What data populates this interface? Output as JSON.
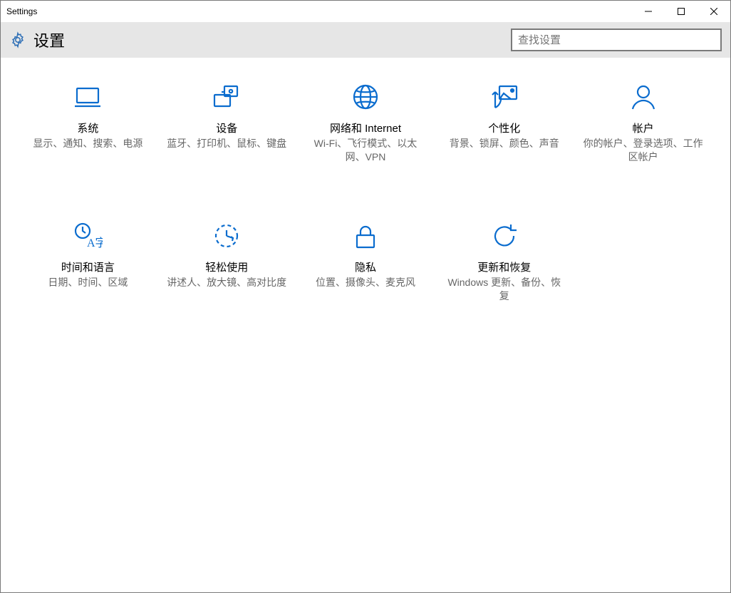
{
  "window": {
    "title": "Settings"
  },
  "header": {
    "title": "设置"
  },
  "search": {
    "placeholder": "查找设置"
  },
  "tiles": [
    {
      "icon": "system",
      "title": "系统",
      "desc": "显示、通知、搜索、电源"
    },
    {
      "icon": "devices",
      "title": "设备",
      "desc": "蓝牙、打印机、鼠标、键盘"
    },
    {
      "icon": "network",
      "title": "网络和 Internet",
      "desc": "Wi-Fi、飞行模式、以太网、VPN"
    },
    {
      "icon": "personal",
      "title": "个性化",
      "desc": "背景、锁屏、颜色、声音"
    },
    {
      "icon": "account",
      "title": "帐户",
      "desc": "你的帐户、登录选项、工作区帐户"
    },
    {
      "icon": "time",
      "title": "时间和语言",
      "desc": "日期、时间、区域"
    },
    {
      "icon": "ease",
      "title": "轻松使用",
      "desc": "讲述人、放大镜、高对比度"
    },
    {
      "icon": "privacy",
      "title": "隐私",
      "desc": "位置、摄像头、麦克风"
    },
    {
      "icon": "update",
      "title": "更新和恢复",
      "desc": "Windows 更新、备份、恢复"
    }
  ]
}
